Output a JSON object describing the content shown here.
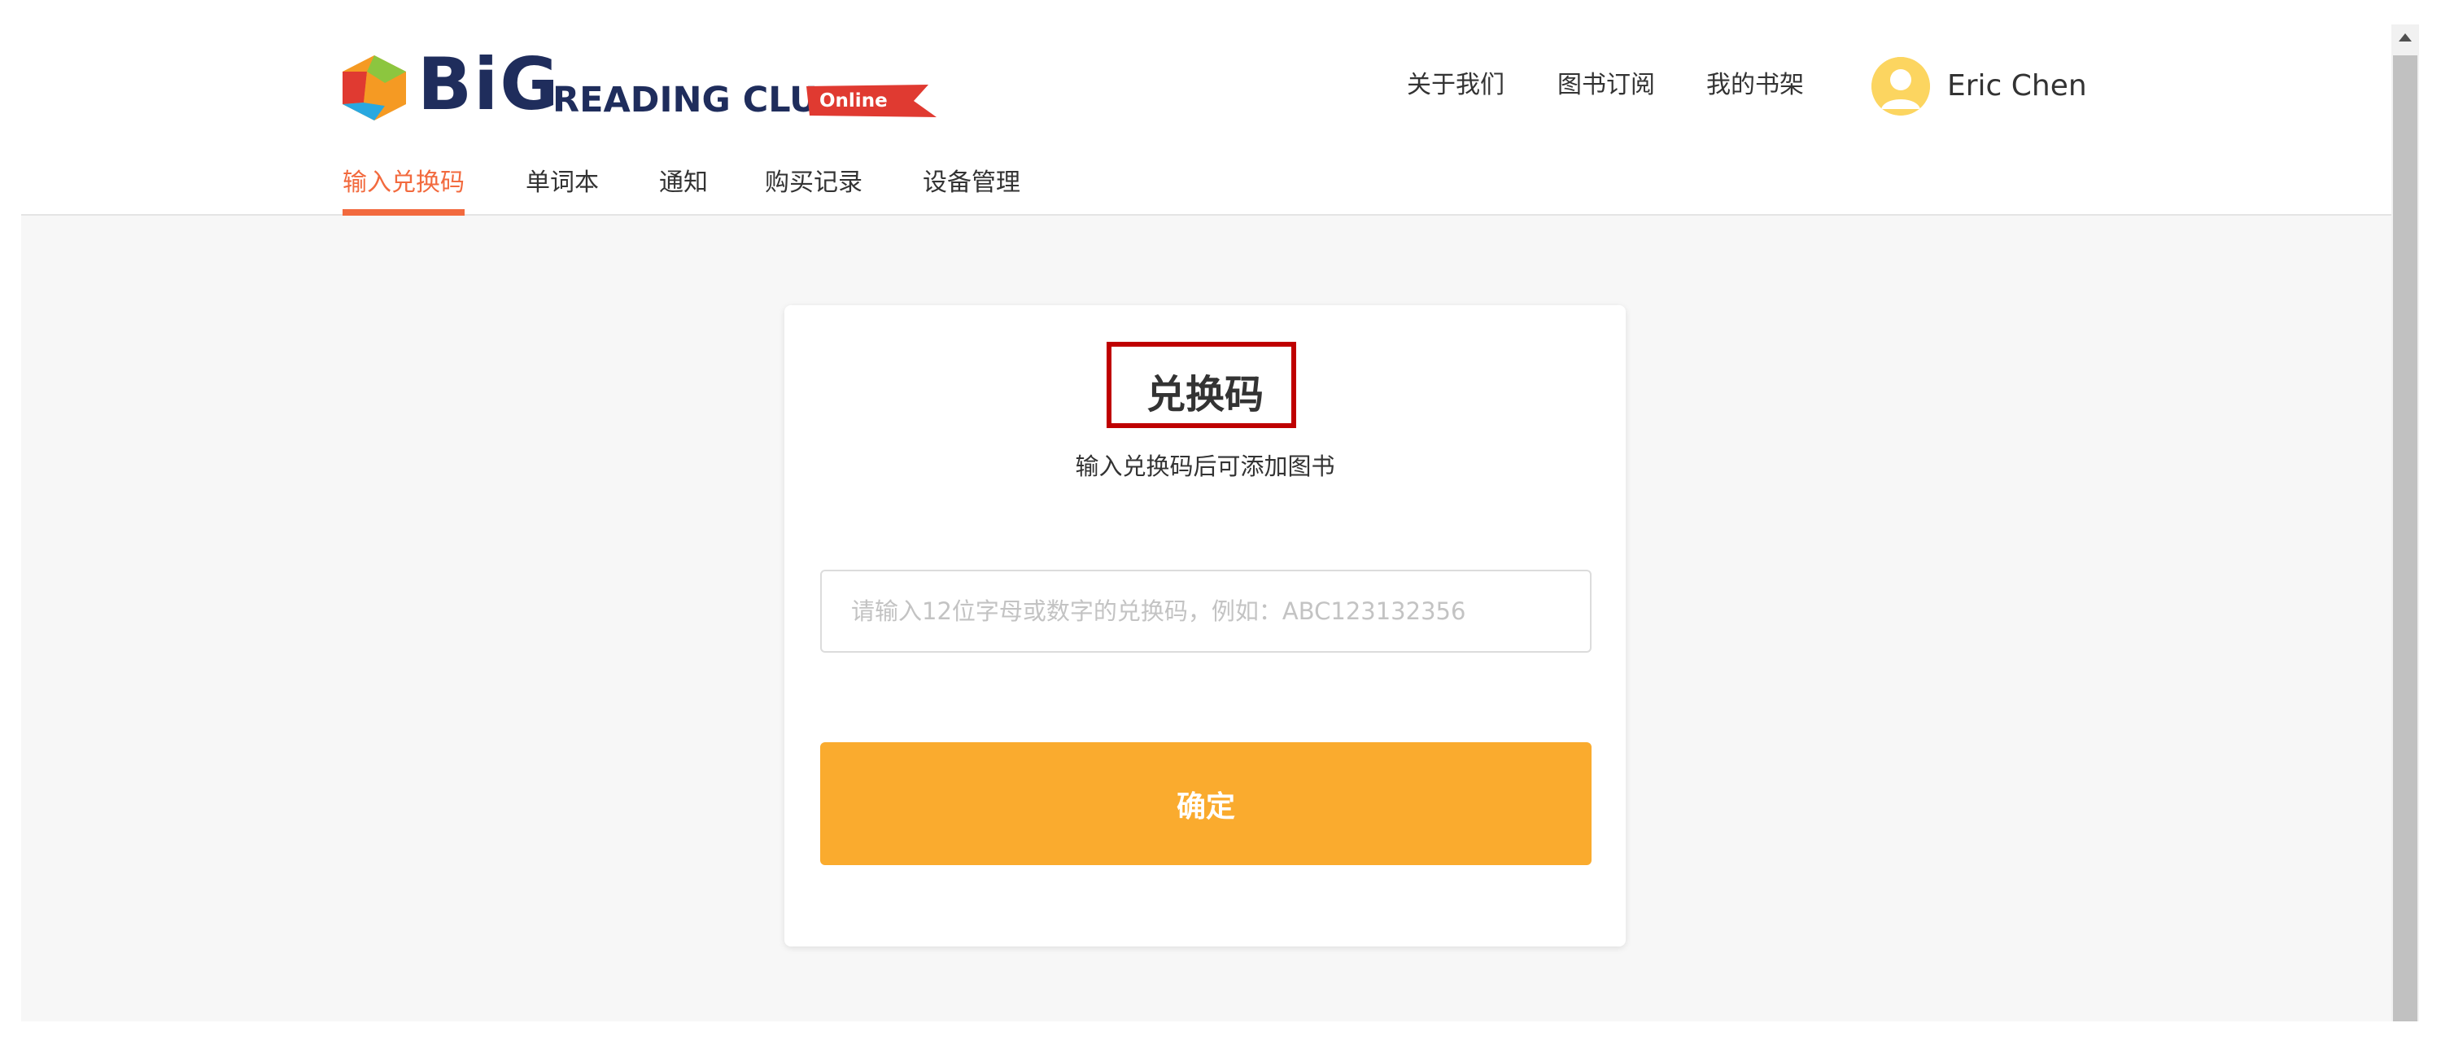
{
  "brand": {
    "logo_big": "BiG",
    "logo_reading_club": "READING CLUB",
    "logo_online": "Online",
    "colors": {
      "navy": "#1f2d5c",
      "red": "#e03a31",
      "orange": "#f59a23",
      "green": "#8cc63f",
      "blue": "#29a8e0"
    }
  },
  "top_nav": {
    "items": [
      {
        "label": "关于我们"
      },
      {
        "label": "图书订阅"
      },
      {
        "label": "我的书架"
      }
    ]
  },
  "user": {
    "name": "Eric Chen",
    "avatar_icon": "user-avatar-icon"
  },
  "sub_nav": {
    "items": [
      {
        "label": "输入兑换码",
        "active": true
      },
      {
        "label": "单词本",
        "active": false
      },
      {
        "label": "通知",
        "active": false
      },
      {
        "label": "购买记录",
        "active": false
      },
      {
        "label": "设备管理",
        "active": false
      }
    ],
    "active_color": "#f26a3e"
  },
  "redeem_card": {
    "title": "兑换码",
    "subtitle": "输入兑换码后可添加图书",
    "input": {
      "value": "",
      "placeholder": "请输入12位字母或数字的兑换码，例如：ABC123132356"
    },
    "confirm_label": "确定",
    "confirm_color": "#faab2e",
    "highlight_color": "#bf0000"
  }
}
